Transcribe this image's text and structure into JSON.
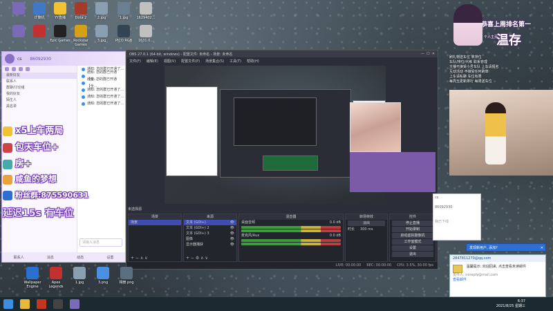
{
  "desktop": {
    "icons_top": [
      {
        "label": "",
        "color": "#7a6ab8"
      },
      {
        "label": "计算机",
        "color": "#3f78c4"
      },
      {
        "label": "YY直播",
        "color": "#f2c232"
      },
      {
        "label": "Dota 2",
        "color": "#a33a2a"
      },
      {
        "label": "2.jpg",
        "color": "#8aa0b0"
      },
      {
        "label": "1.jpg",
        "color": "#6a8090"
      },
      {
        "label": "1629402...",
        "color": "#c0c0c0"
      }
    ],
    "icons_row2": [
      {
        "label": "",
        "color": "#7a6ab8"
      },
      {
        "label": "",
        "color": "#c23030"
      },
      {
        "label": "Epic Games",
        "color": "#222222"
      },
      {
        "label": "Rockstar Games",
        "color": "#d4a017"
      },
      {
        "label": "3.jpg",
        "color": "#8aa0b0"
      },
      {
        "label": "PICO RGB",
        "color": "#334455"
      },
      {
        "label": "1631.0...",
        "color": "#c0c0c0"
      }
    ],
    "icons_bottom": [
      {
        "label": "Wallpaper Engine",
        "color": "#2b6fd1"
      },
      {
        "label": "Apex Legends",
        "color": "#c23030"
      },
      {
        "label": "1.jpg",
        "color": "#8aa0b0"
      },
      {
        "label": "3.png",
        "color": "#4a90e2"
      },
      {
        "label": "相册.png",
        "color": "#5a7080"
      }
    ]
  },
  "qq": {
    "title": "cs",
    "number": "86092930",
    "group_name": "最新好友",
    "search_placeholder": "搜索",
    "list_items": [
      "联系人 ",
      "群聊/讨论组",
      "我的好友",
      "陌生人",
      "黑名单"
    ],
    "selected_item": "我的好友",
    "notices": [
      "通知: 您的群已开通了...",
      "通知: 您的群已开通【全...",
      "通知: 您的群已开通【全...",
      "通知: 您的群已开通了...",
      "通知: 您的群已开通了...",
      "通知: 您的群已开通了..."
    ],
    "input_placeholder": "请输入消息",
    "bottom_tabs": [
      "联系人",
      "消息",
      "动态",
      "设置"
    ],
    "accent": "#8a6fc7"
  },
  "promo": {
    "line1": "x5上车两局",
    "line2": "包天车位+",
    "line3": "房+",
    "line4": "咸鱼的梦想",
    "line5": "粉丝群:875590631",
    "line6": "延迟15s 有车位"
  },
  "obs": {
    "title": "OBS 27.0.1 (64-bit, windows) - 配置文件: 未命名 - 场景: 未命名",
    "menu": [
      "文件(F)",
      "编辑(E)",
      "视图(V)",
      "配置文件(P)",
      "场景集合(S)",
      "工具(T)",
      "帮助(H)"
    ],
    "no_source": "未选择源",
    "panels": {
      "scenes": {
        "title": "场景",
        "items": [
          "场景"
        ]
      },
      "sources": {
        "title": "来源",
        "items": [
          "文本 (GDI+)",
          "文本 (GDI+) 2",
          "文本 (GDI+) 3",
          "图像",
          "显示器捕获"
        ]
      },
      "mixer": {
        "title": "混音器",
        "tracks": [
          "桌面音频",
          "麦克风/Aux"
        ],
        "levels": [
          "0.0 dB",
          "0.0 dB"
        ]
      },
      "transitions": {
        "title": "转场特效",
        "type": "淡出",
        "duration_label": "时长",
        "duration": "300 ms"
      },
      "controls": {
        "title": "控件",
        "buttons": [
          "停止直播",
          "开始录制",
          "启动虚拟摄像机",
          "工作室模式",
          "设置",
          "退出"
        ]
      }
    },
    "status": [
      "LIVE: 00:00:00",
      "REC: 00:00:00",
      "CPU: 3.5%, 30.00 fps"
    ]
  },
  "right": {
    "header": "恭喜上周排名第一",
    "name": "温存",
    "sub": "个人主页",
    "info": [
      "刷礼物送车位 拿排位",
      "车队/排位/代练 联系管理",
      "主播不接受小号车队 上车请报名",
      "互动活动 不接受任何刷单",
      "上车请私聊 车位有限",
      "每周五更新排行 每周送车位"
    ],
    "chat_labels": [
      "cs",
      "86092930",
      "我已下线"
    ],
    "popup_title": "发现新用户, 添加?",
    "mail_header": "2847811270@qq.com",
    "mail_body_1": "温馨提示: 欢迎回来, 点击查看未读邮件",
    "mail_body_2": "发件人: noreply@mail.com",
    "mail_link": "查看邮件"
  },
  "taskbar": {
    "time": "6:37",
    "date": "2021/8/25 星期三"
  }
}
